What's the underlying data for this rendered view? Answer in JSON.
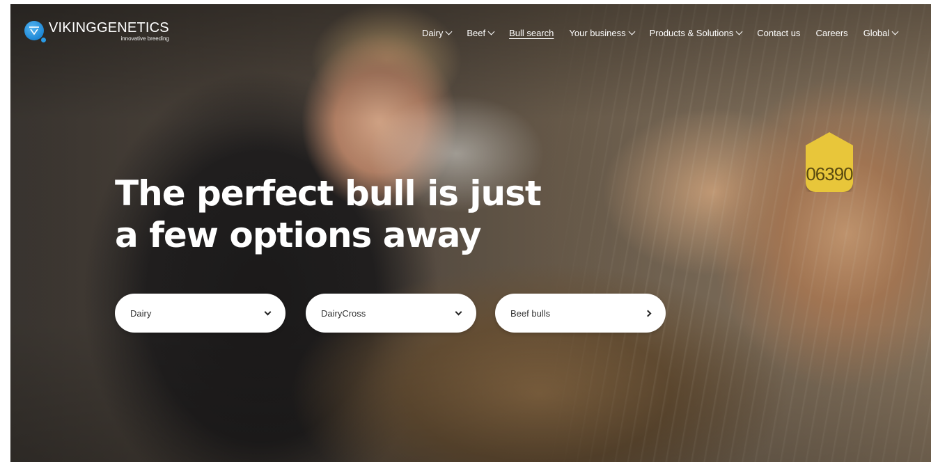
{
  "header": {
    "logo": {
      "title": "VIKINGGENETICS",
      "tagline": "innovative breeding"
    },
    "nav": [
      {
        "label": "Dairy",
        "has_dropdown": true
      },
      {
        "label": "Beef",
        "has_dropdown": true
      },
      {
        "label": "Bull search",
        "active": true
      },
      {
        "label": "Your business",
        "has_dropdown": true
      },
      {
        "label": "Products & Solutions",
        "has_dropdown": true
      },
      {
        "label": "Contact us"
      },
      {
        "label": "Careers"
      },
      {
        "label": "Global",
        "has_dropdown": true
      }
    ]
  },
  "hero": {
    "headline_line1": "The perfect bull is just",
    "headline_line2": "a few options away",
    "ear_tag_number": "06390",
    "selectors": [
      {
        "label": "Dairy",
        "icon": "chevron-down-icon"
      },
      {
        "label": "DairyCross",
        "icon": "chevron-down-icon"
      },
      {
        "label": "Beef bulls",
        "icon": "chevron-right-icon"
      }
    ]
  },
  "colors": {
    "brand_blue": "#1e88d6",
    "text_white": "#ffffff",
    "ear_tag": "#e8c63a"
  }
}
